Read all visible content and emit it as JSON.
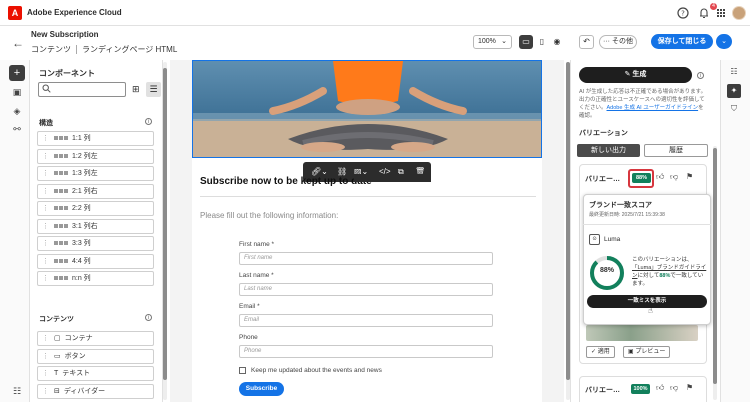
{
  "app": {
    "title": "Adobe Experience Cloud",
    "logo_text": "A",
    "notification_count": "4"
  },
  "header": {
    "title": "New Subscription",
    "breadcrumb_1": "コンテンツ",
    "breadcrumb_2": "ランディングページ HTML",
    "zoom": "100%",
    "more_label": "その他",
    "save_label": "保存して閉じる"
  },
  "left_panel": {
    "title": "コンポーネント",
    "search_placeholder": "",
    "structure_title": "構造",
    "structure_items": [
      "1:1 列",
      "1:2 列左",
      "1:3 列左",
      "2:1 列右",
      "2:2 列",
      "3:1 列右",
      "3:3 列",
      "4:4 列",
      "n:n 列"
    ],
    "content_title": "コンテンツ",
    "content_items": [
      "コンテナ",
      "ボタン",
      "テキスト",
      "ディバイダー"
    ]
  },
  "email": {
    "heading": "Subscribe now to be kept up to date",
    "intro": "Please fill out the following information:",
    "fields": [
      {
        "label": "First name",
        "required": "*",
        "placeholder": "First name"
      },
      {
        "label": "Last name",
        "required": "*",
        "placeholder": "Last name"
      },
      {
        "label": "Email",
        "required": "*",
        "placeholder": "Email"
      },
      {
        "label": "Phone",
        "required": "",
        "placeholder": "Phone"
      }
    ],
    "checkbox_label": "Keep me updated about the events and news",
    "subscribe_label": "Subscribe"
  },
  "right_panel": {
    "generate_label": "生成",
    "disclaimer_1": "AI が生成した応答は不正確である場合があります。出力の正確性とユースケースへの適切性を評価してください。",
    "disclaimer_link": "Adobe 生成 AI ユーザーガイドライン",
    "disclaimer_2": "を確認。",
    "variations_title": "バリエーション",
    "tab_new": "新しい出力",
    "tab_history": "履歴",
    "card1_title": "バリエー…",
    "card1_score": "88%",
    "card2_title": "バリエー…",
    "card2_score": "100%",
    "apply_label": "適用",
    "preview_label": "プレビュー"
  },
  "popover": {
    "title": "ブランド一致スコア",
    "date": "最終更新日時: 2025/7/21 15:39:38",
    "brand_logo": "⊙",
    "brand_name": "Luma",
    "score": "88%",
    "score_value": 88,
    "desc_1": "このバリエーションは、",
    "desc_link": "「Luma」ブランドガイドライン",
    "desc_2": "に対して",
    "desc_pct": "88%",
    "desc_3": "で一致しています。",
    "button_label": "一致ミスを表示"
  },
  "colors": {
    "accent": "#1473e6",
    "success": "#12805c",
    "highlight": "#d7373f"
  },
  "icons": {
    "back": "arrow-left-icon",
    "help": "help-icon",
    "bell": "bell-icon",
    "apps": "app-grid-icon",
    "undo": "undo-icon",
    "search": "search-icon",
    "sparkle": "sparkle-icon"
  }
}
